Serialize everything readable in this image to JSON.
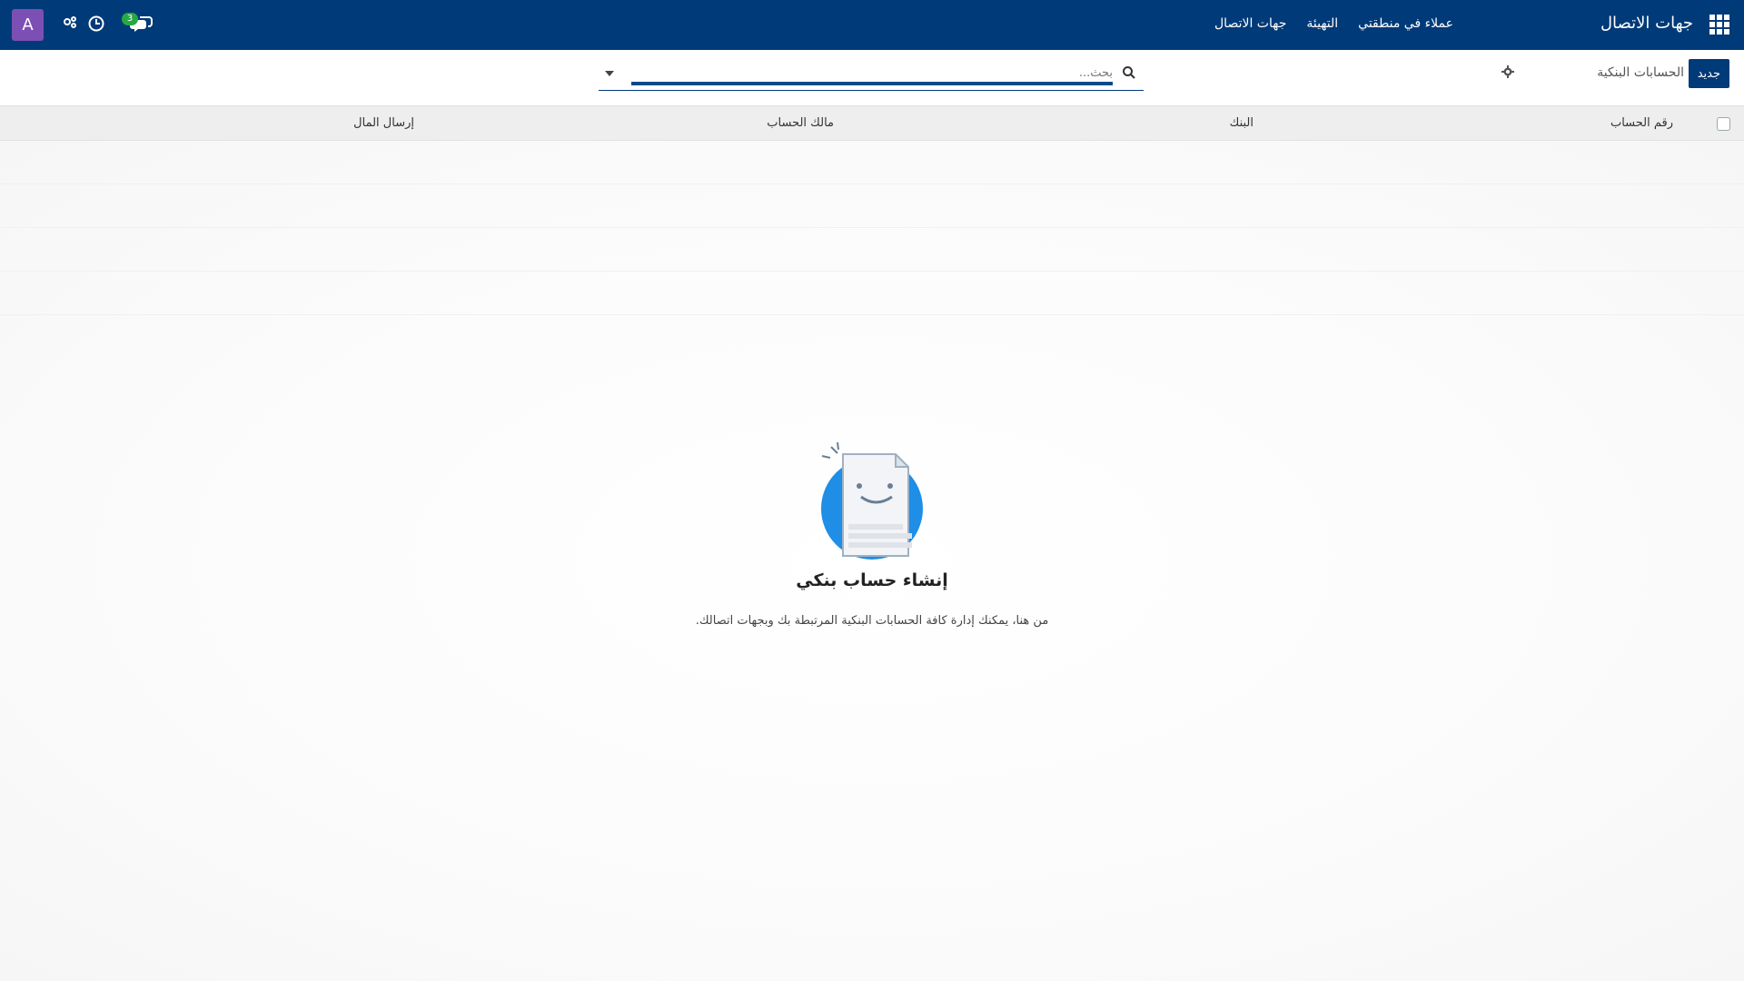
{
  "navbar": {
    "brand": "جهات الاتصال",
    "menu": [
      "جهات الاتصال",
      "التهيئة",
      "عملاء في منطقتي"
    ],
    "avatar_letter": "A",
    "chat_badge": "3",
    "colors": {
      "bar": "#003a78",
      "avatar": "#7c4fb5",
      "badge": "#28a745"
    }
  },
  "control_panel": {
    "new_label": "جديد",
    "breadcrumb": "الحسابات البنكية",
    "search_placeholder": "بحث..."
  },
  "table": {
    "columns": [
      "رقم الحساب",
      "البنك",
      "مالك الحساب",
      "إرسال المال"
    ]
  },
  "empty_state": {
    "title": "إنشاء حساب بنكي",
    "text": "من هنا، يمكنك إدارة كافة الحسابات البنكية المرتبطة بك وبجهات اتصالك."
  }
}
